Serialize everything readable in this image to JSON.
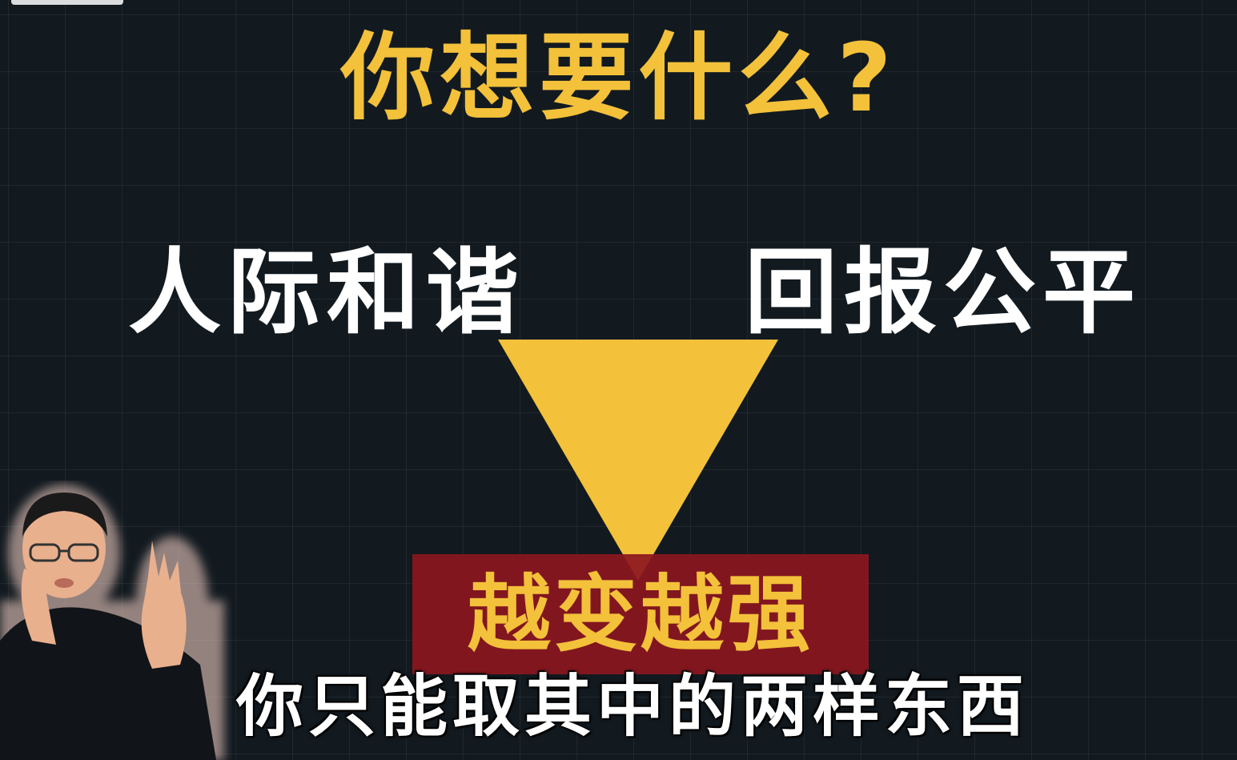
{
  "title": "你想要什么?",
  "nodes": {
    "left": "人际和谐",
    "right": "回报公平",
    "bottom": "越变越强"
  },
  "subtitle": "你只能取其中的两样东西",
  "colors": {
    "background": "#121a20",
    "accent_yellow": "#f3c13a",
    "highlight_red": "#8c1620",
    "text_white": "#ffffff"
  }
}
